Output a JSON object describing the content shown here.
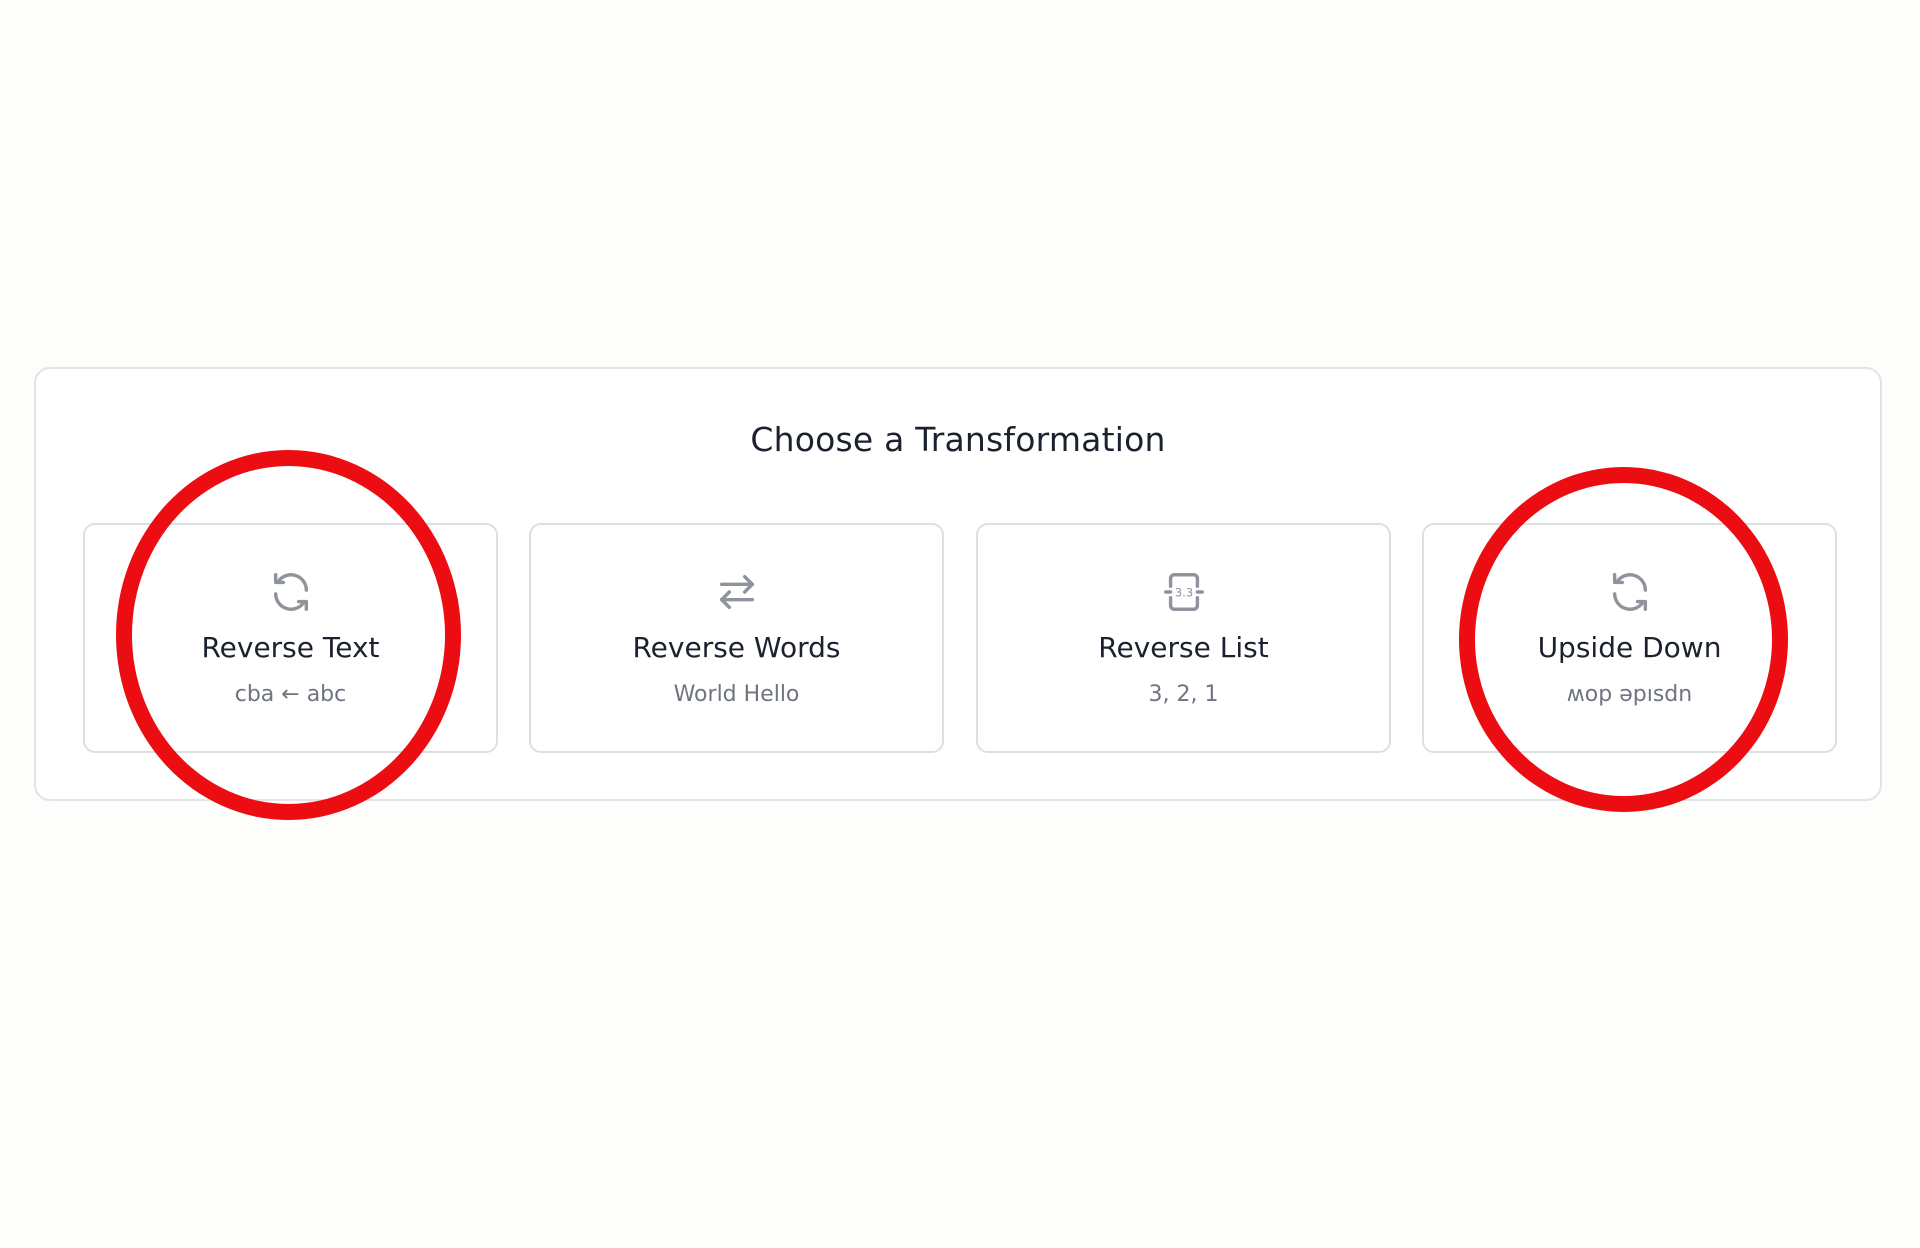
{
  "panel": {
    "title": "Choose a Transformation"
  },
  "cards": [
    {
      "label": "Reverse Text",
      "example": "cba ← abc",
      "icon": "refresh-icon"
    },
    {
      "label": "Reverse Words",
      "example": "World Hello",
      "icon": "swap-arrows-icon"
    },
    {
      "label": "Reverse List",
      "example": "3, 2, 1",
      "icon": "list-reverse-icon"
    },
    {
      "label": "Upside Down",
      "example": "ʍop ǝpısdn",
      "icon": "refresh-icon"
    }
  ],
  "annotations": {
    "highlighted_cards": [
      "Reverse Text",
      "Upside Down"
    ],
    "highlight_color": "#ec0d12"
  },
  "colors": {
    "background": "#fdfdfc",
    "panel_border": "#e2e4e8",
    "card_border": "#dcdfe4",
    "title_text": "#1c2130",
    "secondary_text": "#6f7480",
    "icon_color": "#8f949c"
  },
  "icon_glyphs": {
    "list_reverse": "3.3"
  }
}
